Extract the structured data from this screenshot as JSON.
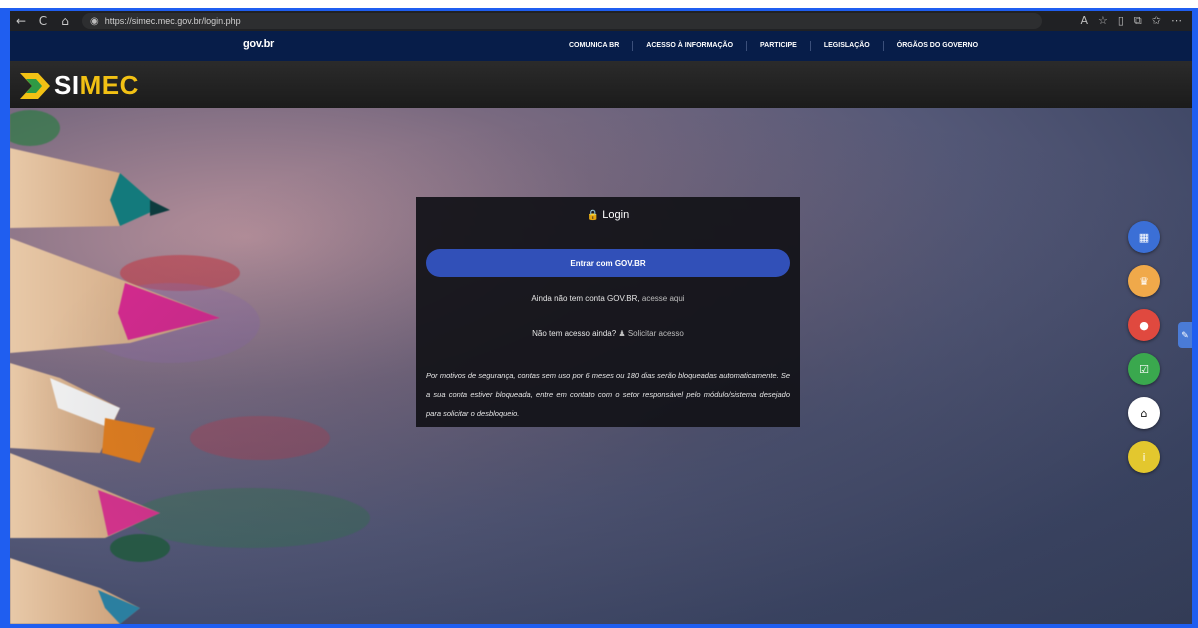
{
  "browser": {
    "back_icon": "←",
    "refresh_icon": "C",
    "home_icon": "⌂",
    "url": "https://simec.mec.gov.br/login.php"
  },
  "gov_bar": {
    "logo": "gov.br",
    "nav": [
      "COMUNICA BR",
      "ACESSO À INFORMAÇÃO",
      "PARTICIPE",
      "LEGISLAÇÃO",
      "ÓRGÃOS DO GOVERNO"
    ]
  },
  "simec": {
    "brand": {
      "part1": "SI",
      "part2": "MEC"
    }
  },
  "login": {
    "title": "Login",
    "govbr_button": "Entrar com GOV.BR",
    "no_account_text": "Ainda não tem conta GOV.BR,",
    "no_account_link": "acesse aqui",
    "no_access_text": "Não tem acesso ainda?",
    "no_access_link": "Solicitar acesso",
    "warning": "Por motivos de segurança, contas sem uso por 6 meses ou 180 dias serão bloqueadas automaticamente. Se a sua conta estiver bloqueada, entre em contato com o setor responsável pelo módulo/sistema desejado para solicitar o desbloqueio."
  },
  "side_icons": [
    {
      "name": "grid-icon",
      "glyph": "▦",
      "color": "#3b6fd6"
    },
    {
      "name": "trophy-icon",
      "glyph": "♛",
      "color": "#f0a94a"
    },
    {
      "name": "chat-icon",
      "glyph": "●",
      "color": "#e0493f"
    },
    {
      "name": "checkbox-icon",
      "glyph": "☑",
      "color": "#3aa84e"
    },
    {
      "name": "bank-icon",
      "glyph": "⌂",
      "color": "#ffffff"
    },
    {
      "name": "info-icon",
      "glyph": "i",
      "color": "#e3c72e"
    }
  ],
  "colors": {
    "gov_blue": "#071d49",
    "button_blue": "#3150b8",
    "simec_yellow": "#f2c114"
  }
}
